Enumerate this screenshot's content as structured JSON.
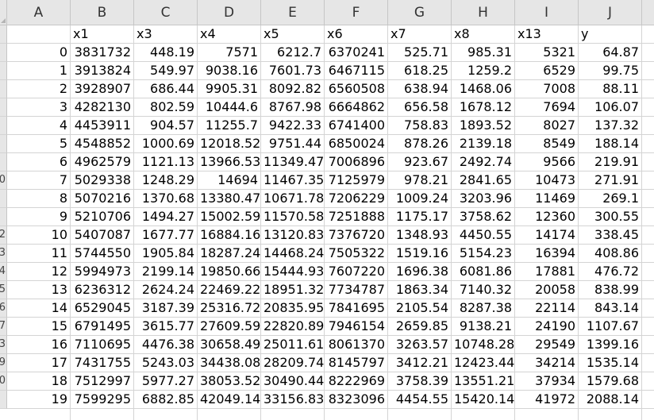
{
  "columns": [
    "A",
    "B",
    "C",
    "D",
    "E",
    "F",
    "G",
    "H",
    "I",
    "J"
  ],
  "header_row": [
    "",
    "x1",
    "x3",
    "x4",
    "x5",
    "x6",
    "x7",
    "x8",
    "x13",
    "y"
  ],
  "rows": [
    [
      "0",
      "3831732",
      "448.19",
      "7571",
      "6212.7",
      "6370241",
      "525.71",
      "985.31",
      "5321",
      "64.87"
    ],
    [
      "1",
      "3913824",
      "549.97",
      "9038.16",
      "7601.73",
      "6467115",
      "618.25",
      "1259.2",
      "6529",
      "99.75"
    ],
    [
      "2",
      "3928907",
      "686.44",
      "9905.31",
      "8092.82",
      "6560508",
      "638.94",
      "1468.06",
      "7008",
      "88.11"
    ],
    [
      "3",
      "4282130",
      "802.59",
      "10444.6",
      "8767.98",
      "6664862",
      "656.58",
      "1678.12",
      "7694",
      "106.07"
    ],
    [
      "4",
      "4453911",
      "904.57",
      "11255.7",
      "9422.33",
      "6741400",
      "758.83",
      "1893.52",
      "8027",
      "137.32"
    ],
    [
      "5",
      "4548852",
      "1000.69",
      "12018.52",
      "9751.44",
      "6850024",
      "878.26",
      "2139.18",
      "8549",
      "188.14"
    ],
    [
      "6",
      "4962579",
      "1121.13",
      "13966.53",
      "11349.47",
      "7006896",
      "923.67",
      "2492.74",
      "9566",
      "219.91"
    ],
    [
      "7",
      "5029338",
      "1248.29",
      "14694",
      "11467.35",
      "7125979",
      "978.21",
      "2841.65",
      "10473",
      "271.91"
    ],
    [
      "8",
      "5070216",
      "1370.68",
      "13380.47",
      "10671.78",
      "7206229",
      "1009.24",
      "3203.96",
      "11469",
      "269.1"
    ],
    [
      "9",
      "5210706",
      "1494.27",
      "15002.59",
      "11570.58",
      "7251888",
      "1175.17",
      "3758.62",
      "12360",
      "300.55"
    ],
    [
      "10",
      "5407087",
      "1677.77",
      "16884.16",
      "13120.83",
      "7376720",
      "1348.93",
      "4450.55",
      "14174",
      "338.45"
    ],
    [
      "11",
      "5744550",
      "1905.84",
      "18287.24",
      "14468.24",
      "7505322",
      "1519.16",
      "5154.23",
      "16394",
      "408.86"
    ],
    [
      "12",
      "5994973",
      "2199.14",
      "19850.66",
      "15444.93",
      "7607220",
      "1696.38",
      "6081.86",
      "17881",
      "476.72"
    ],
    [
      "13",
      "6236312",
      "2624.24",
      "22469.22",
      "18951.32",
      "7734787",
      "1863.34",
      "7140.32",
      "20058",
      "838.99"
    ],
    [
      "14",
      "6529045",
      "3187.39",
      "25316.72",
      "20835.95",
      "7841695",
      "2105.54",
      "8287.38",
      "22114",
      "843.14"
    ],
    [
      "15",
      "6791495",
      "3615.77",
      "27609.59",
      "22820.89",
      "7946154",
      "2659.85",
      "9138.21",
      "24190",
      "1107.67"
    ],
    [
      "16",
      "7110695",
      "4476.38",
      "30658.49",
      "25011.61",
      "8061370",
      "3263.57",
      "10748.28",
      "29549",
      "1399.16"
    ],
    [
      "17",
      "7431755",
      "5243.03",
      "34438.08",
      "28209.74",
      "8145797",
      "3412.21",
      "12423.44",
      "34214",
      "1535.14"
    ],
    [
      "18",
      "7512997",
      "5977.27",
      "38053.52",
      "30490.44",
      "8222969",
      "3758.39",
      "13551.21",
      "37934",
      "1579.68"
    ],
    [
      "19",
      "7599295",
      "6882.85",
      "42049.14",
      "33156.83",
      "8323096",
      "4454.55",
      "15420.14",
      "41972",
      "2088.14"
    ]
  ],
  "row_header_glyphs": [
    "",
    "",
    "",
    "",
    "",
    "",
    "",
    "",
    "0",
    "",
    "",
    "2",
    "3",
    "4",
    "5",
    "6",
    "7",
    "3",
    "9",
    "0",
    ""
  ]
}
